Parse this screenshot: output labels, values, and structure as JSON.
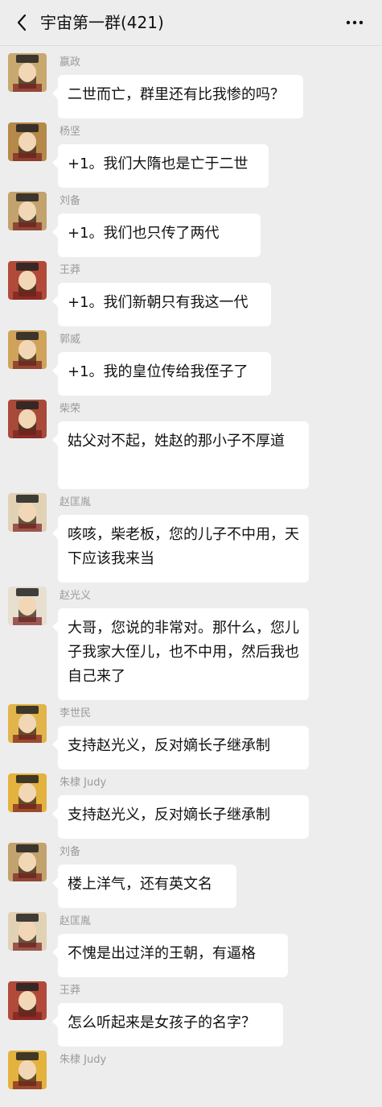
{
  "header": {
    "title": "宇宙第一群(421)"
  },
  "messages": [
    {
      "sender": "嬴政",
      "text": "二世而亡，群里还有比我惨的吗？",
      "avatar_icon": "emperor-avatar",
      "avatar_color": "#c9a870"
    },
    {
      "sender": "杨坚",
      "text": "+1。我们大隋也是亡于二世",
      "avatar_icon": "emperor-avatar",
      "avatar_color": "#b5894a"
    },
    {
      "sender": "刘备",
      "text": "+1。我们也只传了两代",
      "avatar_icon": "emperor-avatar",
      "avatar_color": "#c2a26d"
    },
    {
      "sender": "王莽",
      "text": "+1。我们新朝只有我这一代",
      "avatar_icon": "emperor-avatar",
      "avatar_color": "#b24a3a"
    },
    {
      "sender": "郭威",
      "text": "+1。我的皇位传给我侄子了",
      "avatar_icon": "emperor-avatar",
      "avatar_color": "#cfa35a"
    },
    {
      "sender": "柴荣",
      "text": "姑父对不起，姓赵的那小子不厚道",
      "avatar_icon": "emperor-avatar",
      "avatar_color": "#a74a3a"
    },
    {
      "sender": "赵匡胤",
      "text": "咳咳，柴老板，您的儿子不中用，天下应该我来当",
      "avatar_icon": "emperor-avatar",
      "avatar_color": "#e1d2b6"
    },
    {
      "sender": "赵光义",
      "text": "大哥，您说的非常对。那什么，您儿子我家大侄儿，也不中用，然后我也自己来了",
      "avatar_icon": "emperor-avatar",
      "avatar_color": "#e7dfcf"
    },
    {
      "sender": "李世民",
      "text": "支持赵光义，反对嫡长子继承制",
      "avatar_icon": "emperor-avatar",
      "avatar_color": "#e2b44c"
    },
    {
      "sender": "朱棣 Judy",
      "text": "支持赵光义，反对嫡长子继承制",
      "avatar_icon": "emperor-avatar",
      "avatar_color": "#e3b23f"
    },
    {
      "sender": "刘备",
      "text": "楼上洋气，还有英文名",
      "avatar_icon": "emperor-avatar",
      "avatar_color": "#c2a26d"
    },
    {
      "sender": "赵匡胤",
      "text": "不愧是出过洋的王朝，有逼格",
      "avatar_icon": "emperor-avatar",
      "avatar_color": "#e1d2b6"
    },
    {
      "sender": "王莽",
      "text": "怎么听起来是女孩子的名字？",
      "avatar_icon": "emperor-avatar",
      "avatar_color": "#b24a3a"
    },
    {
      "sender": "朱棣 Judy",
      "text": "",
      "avatar_icon": "emperor-avatar",
      "avatar_color": "#e3b23f"
    }
  ]
}
